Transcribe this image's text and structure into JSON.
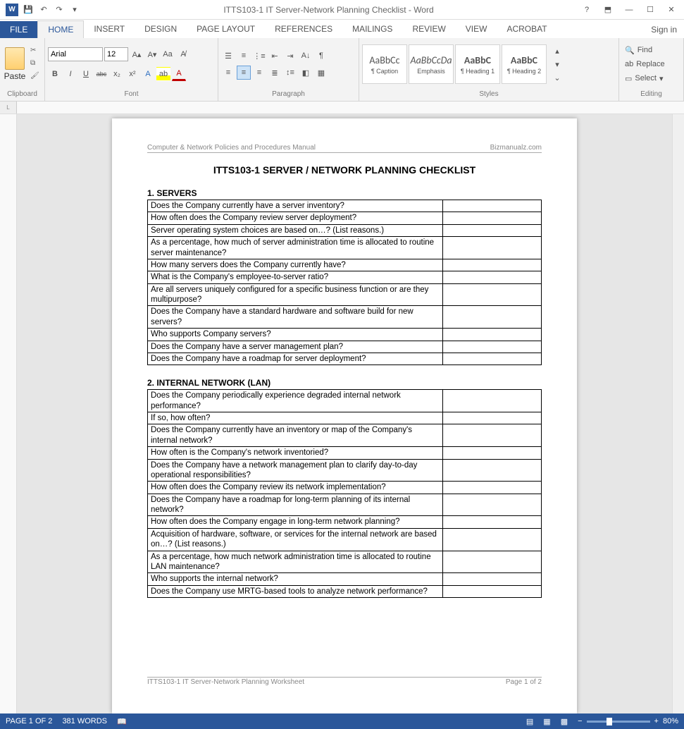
{
  "titlebar": {
    "app_glyph": "W",
    "title": "ITTS103-1 IT Server-Network Planning Checklist - Word",
    "help_glyph": "?"
  },
  "tabs": {
    "file": "FILE",
    "items": [
      "HOME",
      "INSERT",
      "DESIGN",
      "PAGE LAYOUT",
      "REFERENCES",
      "MAILINGS",
      "REVIEW",
      "VIEW",
      "ACROBAT"
    ],
    "active_index": 0,
    "signin": "Sign in"
  },
  "ribbon": {
    "clipboard": {
      "paste": "Paste",
      "label": "Clipboard"
    },
    "font": {
      "name": "Arial",
      "size": "12",
      "label": "Font",
      "bold": "B",
      "italic": "I",
      "under": "U",
      "strike": "abc",
      "sub": "x₂",
      "sup": "x²"
    },
    "paragraph": {
      "label": "Paragraph"
    },
    "styles": {
      "label": "Styles",
      "items": [
        {
          "prev": "AaBbCc",
          "name": "¶ Caption"
        },
        {
          "prev": "AaBbCcDa",
          "name": "Emphasis"
        },
        {
          "prev": "AaBbC",
          "name": "¶ Heading 1"
        },
        {
          "prev": "AaBbC",
          "name": "¶ Heading 2"
        }
      ]
    },
    "editing": {
      "find": "Find",
      "replace": "Replace",
      "select": "Select",
      "label": "Editing"
    }
  },
  "document": {
    "header_left": "Computer & Network Policies and Procedures Manual",
    "header_right": "Bizmanualz.com",
    "title": "ITTS103-1   SERVER / NETWORK PLANNING CHECKLIST",
    "sections": [
      {
        "heading": "1. SERVERS",
        "rows": [
          "Does the Company currently have a server inventory?",
          "How often does the Company review server deployment?",
          "Server operating system choices are based on…?  (List reasons.)",
          "As a percentage, how much of server administration time is allocated to routine server maintenance?",
          "How many servers does the Company currently have?",
          "What is the Company's employee-to-server ratio?",
          "Are all servers uniquely configured for a specific business function or are they multipurpose?",
          "Does the Company have a standard hardware and software build for new servers?",
          "Who supports Company servers?",
          "Does the Company have a server management plan?",
          "Does the Company have a roadmap for server deployment?"
        ]
      },
      {
        "heading": "2. INTERNAL NETWORK (LAN)",
        "rows": [
          "Does the Company periodically experience degraded internal network performance?",
          {
            "text": "If so, how often?",
            "indent": true
          },
          "Does the Company currently have an inventory or map of the Company's internal network?",
          "How often is the Company's network inventoried?",
          "Does the Company have a network management plan to clarify day-to-day operational responsibilities?",
          "How often does the Company review its network implementation?",
          "Does the Company have a roadmap for long-term planning of its internal network?",
          "How often does the Company engage in long-term network planning?",
          "Acquisition of hardware, software, or services for the internal network are based on…?  (List reasons.)",
          "As a percentage, how much network administration time is allocated to routine LAN maintenance?",
          "Who supports the internal network?",
          "Does the Company use MRTG-based tools to analyze network performance?"
        ]
      }
    ],
    "footer_left": "ITTS103-1 IT Server-Network Planning Worksheet",
    "footer_right": "Page 1 of 2"
  },
  "statusbar": {
    "page": "PAGE 1 OF 2",
    "words": "381 WORDS",
    "zoom": "80%"
  }
}
